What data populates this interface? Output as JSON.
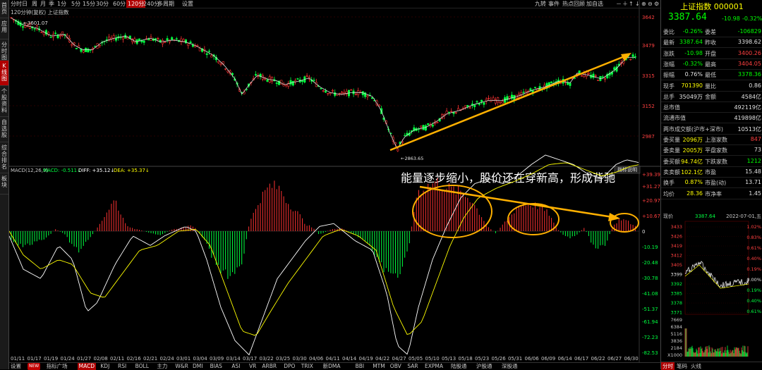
{
  "left_tabs": [
    "首页",
    "应用",
    "分时图",
    "K线图",
    "个股资料",
    "自选股",
    "综合排名",
    "板块"
  ],
  "periods": [
    "分时",
    "日",
    "周",
    "月",
    "季",
    "1分",
    "5分",
    "15分",
    "30分",
    "60分",
    "120分",
    "240分",
    "多周期",
    "设置"
  ],
  "active_period": "120分",
  "toolbar_right": [
    "九转",
    "事件",
    "热点回顾",
    "加自选"
  ],
  "title_line": "120分钟(复权)  上证指数",
  "main_chart": {
    "high_label": "3601.07",
    "low_label": "2863.65",
    "y_ticks": [
      "3642",
      "3479",
      "3315",
      "3152",
      "2987"
    ],
    "x_ticks": [
      "01/11",
      "01/17",
      "01/19",
      "01/24",
      "01/27",
      "02/08",
      "02/11",
      "02/16",
      "02/21",
      "02/24",
      "03/01",
      "03/04",
      "03/09",
      "03/14",
      "03/17",
      "03/22",
      "03/25",
      "03/30",
      "04/06",
      "04/11",
      "04/14",
      "04/19",
      "04/22",
      "04/27",
      "05/05",
      "05/10",
      "05/13",
      "05/18",
      "05/23",
      "05/26",
      "05/31",
      "06/06",
      "06/09",
      "06/14",
      "06/17",
      "06/22",
      "06/27",
      "06/30"
    ],
    "annotation": "能量逐步缩小，股价还在穿新高，形成背驰"
  },
  "macd": {
    "label": "MACD(12,26,9)",
    "macd_val": "MACD: -0.511↓",
    "diff_val": "DIFF: +35.12↓",
    "dea_val": "DEA: +35.37↓",
    "button": "指标说明",
    "y_ticks": [
      "+39.39",
      "+31.27",
      "+20.97",
      "+10.67",
      "0",
      "-10.19",
      "-20.48",
      "-30.78",
      "-41.08",
      "-51.37",
      "-61.94",
      "-72.23",
      "-82.53"
    ]
  },
  "indicators": [
    "设置",
    "NEW",
    "指标广场",
    "MACD",
    "KDJ",
    "RSI",
    "BOLL",
    "主力",
    "W&R",
    "DMI",
    "BIAS",
    "ASI",
    "VR",
    "ARBR",
    "DPO",
    "TRIX",
    "新DMA",
    "BBI",
    "MTM",
    "OBV",
    "SAR",
    "EXPMA",
    "陆股通",
    "沪股通",
    "深股通"
  ],
  "active_indicator": "MACD",
  "right_panel": {
    "title": "上证指数 000001",
    "price": "3387.64",
    "change": "-10.98",
    "change_pct": "-0.32%",
    "rows": [
      {
        "l1": "委比",
        "v1": "-0.26%",
        "l2": "委差",
        "v2": "-106829",
        "c1": "g",
        "c2": "g"
      },
      {
        "l1": "最新",
        "v1": "3387.64",
        "l2": "昨收",
        "v2": "3398.62",
        "c1": "g",
        "c2": "w"
      },
      {
        "l1": "涨跌",
        "v1": "-10.98",
        "l2": "开盘",
        "v2": "3400.26",
        "c1": "g",
        "c2": "r"
      },
      {
        "l1": "涨幅",
        "v1": "-0.32%",
        "l2": "最高",
        "v2": "3404.05",
        "c1": "g",
        "c2": "r"
      },
      {
        "l1": "振幅",
        "v1": "0.76%",
        "l2": "最低",
        "v2": "3378.36",
        "c1": "w",
        "c2": "g"
      },
      {
        "l1": "现手",
        "v1": "701390",
        "l2": "量比",
        "v2": "0.86",
        "c1": "y",
        "c2": "w"
      },
      {
        "l1": "总手",
        "v1": "35049万",
        "l2": "金额",
        "v2": "4584亿",
        "c1": "w",
        "c2": "w"
      },
      {
        "l1": "总市值",
        "v1": "",
        "l2": "",
        "v2": "492119亿",
        "c1": "w",
        "c2": "w"
      },
      {
        "l1": "流通市值",
        "v1": "",
        "l2": "",
        "v2": "419898亿",
        "c1": "w",
        "c2": "w"
      },
      {
        "l1": "两市成交额(沪市+深市)",
        "v1": "",
        "l2": "",
        "v2": "10513亿",
        "c1": "w",
        "c2": "w"
      },
      {
        "l1": "委买量",
        "v1": "2096万",
        "l2": "上涨家数",
        "v2": "847",
        "c1": "y",
        "c2": "r"
      },
      {
        "l1": "委卖量",
        "v1": "2005万",
        "l2": "平盘家数",
        "v2": "73",
        "c1": "y",
        "c2": "w"
      },
      {
        "l1": "委买额",
        "v1": "94.74亿",
        "l2": "下跌家数",
        "v2": "1212",
        "c1": "y",
        "c2": "g"
      },
      {
        "l1": "卖卖额",
        "v1": "102.1亿",
        "l2": "市盈",
        "v2": "15.48",
        "c1": "y",
        "c2": "w"
      },
      {
        "l1": "换手",
        "v1": "0.87%",
        "l2": "市盈(动)",
        "v2": "13.71",
        "c1": "y",
        "c2": "w"
      },
      {
        "l1": "均价",
        "v1": "28.36",
        "l2": "市净率",
        "v2": "1.45",
        "c1": "y",
        "c2": "w"
      }
    ],
    "mini_header": {
      "l": "现价",
      "v": "3387.64",
      "date": "2022-07-01,五"
    },
    "mini_left_ticks": [
      "3433",
      "3426",
      "3419",
      "3412",
      "3405",
      "3399",
      "3392",
      "3385",
      "3378",
      "3371"
    ],
    "mini_right_ticks": [
      "1.02%",
      "0.83%",
      "0.61%",
      "0.40%",
      "0.19%",
      "0.00%",
      "0.19%",
      "0.40%",
      "0.61%"
    ],
    "vol_ticks": [
      "7669",
      "6384",
      "5116",
      "3836",
      "2184",
      "X1000"
    ],
    "bottom_tabs": [
      "分时",
      "笔码",
      "火线"
    ],
    "active_bottom_tab": "分时"
  },
  "colors": {
    "up": "#ff3232",
    "down": "#00ff40",
    "ma": "#e0e0e0",
    "arrow": "#ffb000",
    "diff": "#ffffff",
    "dea": "#ffff00"
  }
}
